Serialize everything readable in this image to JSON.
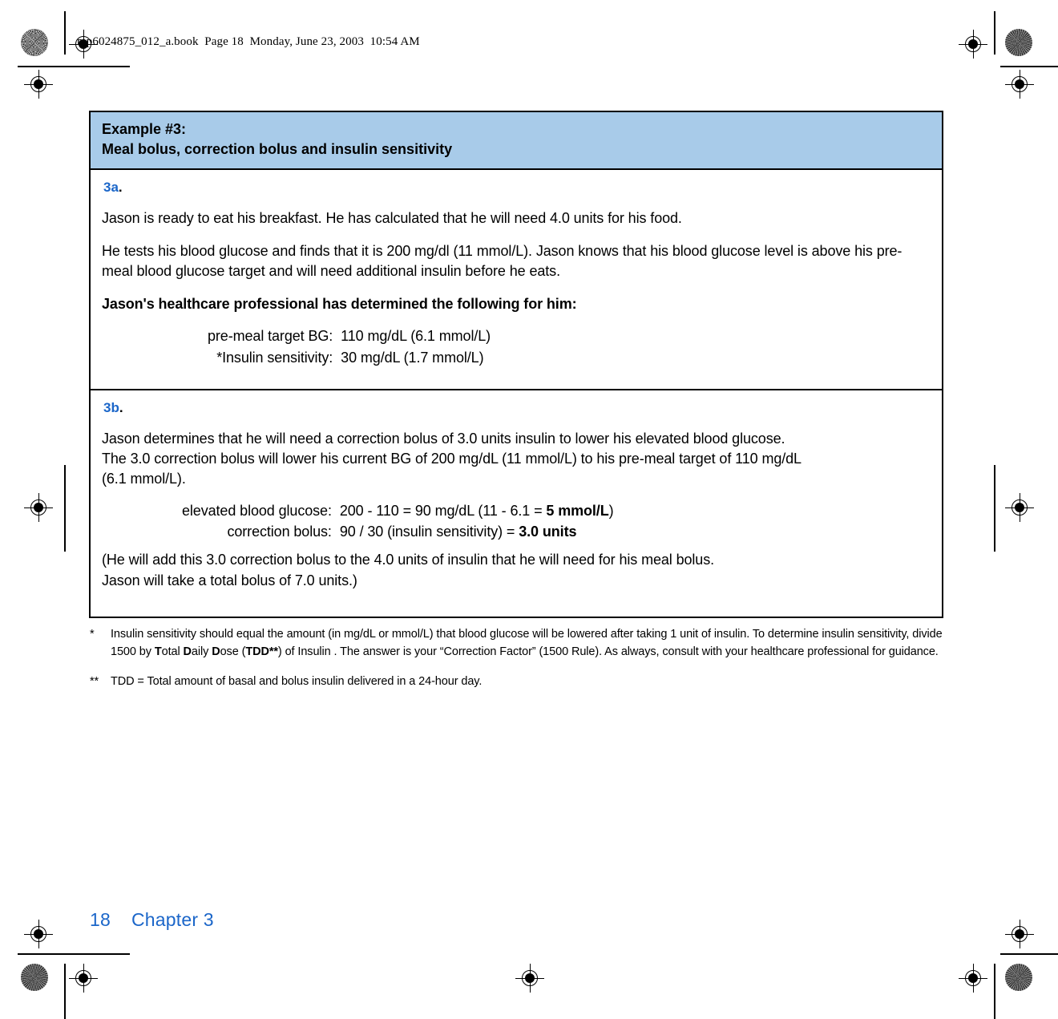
{
  "running_head": "mp6024875_012_a.book  Page 18  Monday, June 23, 2003  10:54 AM",
  "colors": {
    "header_blue": "#a8cbe9",
    "accent_blue": "#1b66c9",
    "rule_black": "#000000"
  },
  "example_box": {
    "header": {
      "line1": "Example #3:",
      "line2": "Meal bolus, correction bolus and insulin sensitivity"
    },
    "section_a": {
      "label": "3a",
      "label_period": ".",
      "paragraphs": [
        "Jason is ready to eat his breakfast. He has calculated that he will need 4.0 units for his food.",
        "He tests his blood glucose and finds that it is 200 mg/dl (11 mmol/L). Jason knows that his blood glucose level is above his pre-meal blood glucose target and will need additional insulin before he eats."
      ],
      "bold_lead": "Jason's healthcare professional has determined the following for him:",
      "values": [
        {
          "label": "pre-meal target BG:",
          "value": "110 mg/dL (6.1 mmol/L)"
        },
        {
          "label": "*Insulin sensitivity:",
          "value": "30 mg/dL (1.7 mmol/L)"
        }
      ]
    },
    "section_b": {
      "label": "3b",
      "label_period": ".",
      "paragraph_lines": [
        "Jason determines that he will need a correction bolus of 3.0 units insulin to lower his elevated blood glucose.",
        "The 3.0 correction bolus will lower his current BG of 200 mg/dL (11 mmol/L) to his pre-meal target of 110 mg/dL",
        "(6.1 mmol/L)."
      ],
      "values": [
        {
          "label": "elevated blood glucose:",
          "value_prefix": "200 - 110 = 90 mg/dL (11 - 6.1 = ",
          "value_bold": "5 mmol/L",
          "value_suffix": ")"
        },
        {
          "label": "correction bolus:",
          "value_prefix": "90 / 30 (insulin sensitivity) = ",
          "value_bold": "3.0 units",
          "value_suffix": ""
        }
      ],
      "closing_lines": [
        "(He will add this 3.0 correction bolus to the 4.0 units of insulin that he will need for his meal bolus.",
        "Jason will take a total bolus of 7.0 units.)"
      ]
    }
  },
  "footnotes": [
    {
      "mark": "*",
      "part1": "Insulin sensitivity should equal the amount (in mg/dL or mmol/L) that blood glucose will be lowered after taking 1 unit of insulin. To determine insulin sensitivity, divide 1500 by ",
      "bold1": "T",
      "part2": "otal ",
      "bold2": "D",
      "part3": "aily ",
      "bold3": "D",
      "part4": "ose (",
      "bold4": "TDD**",
      "part5": ") of Insulin . The answer is your “Correction Factor” (1500 Rule). As always, consult with your healthcare professional for guidance."
    },
    {
      "mark": "**",
      "part1": "TDD = Total amount of basal and bolus insulin delivered in a 24-hour day.",
      "bold1": "",
      "part2": "",
      "bold2": "",
      "part3": "",
      "bold3": "",
      "part4": "",
      "bold4": "",
      "part5": ""
    }
  ],
  "page_footer": {
    "page_number": "18",
    "chapter": "Chapter 3"
  }
}
